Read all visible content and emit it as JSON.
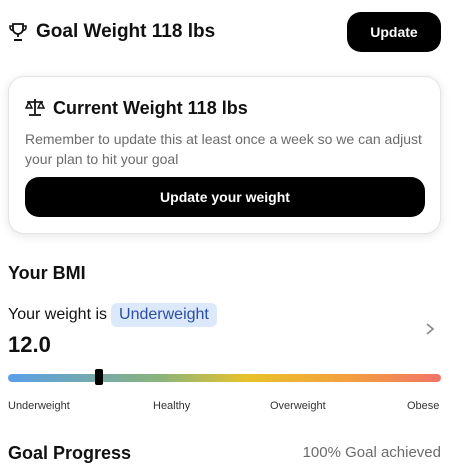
{
  "goal": {
    "title": "Goal Weight 118 lbs",
    "update_label": "Update",
    "icon": "trophy-icon"
  },
  "current_weight_card": {
    "title": "Current Weight 118 lbs",
    "description": "Remember to update this at least once a week so we can adjust your plan to hit your goal",
    "button_label": "Update your weight",
    "icon": "scale-icon"
  },
  "bmi": {
    "title": "Your BMI",
    "weight_label": "Your weight is",
    "category": "Underweight",
    "value": "12.0",
    "scale_labels": [
      "Underweight",
      "Healthy",
      "Overweight",
      "Obese"
    ],
    "marker_position_fraction": 0.21,
    "colors": {
      "badge_bg": "#dce9fb",
      "badge_text": "#2a4fa3"
    }
  },
  "goal_progress": {
    "title": "Goal Progress",
    "status": "100% Goal achieved"
  }
}
